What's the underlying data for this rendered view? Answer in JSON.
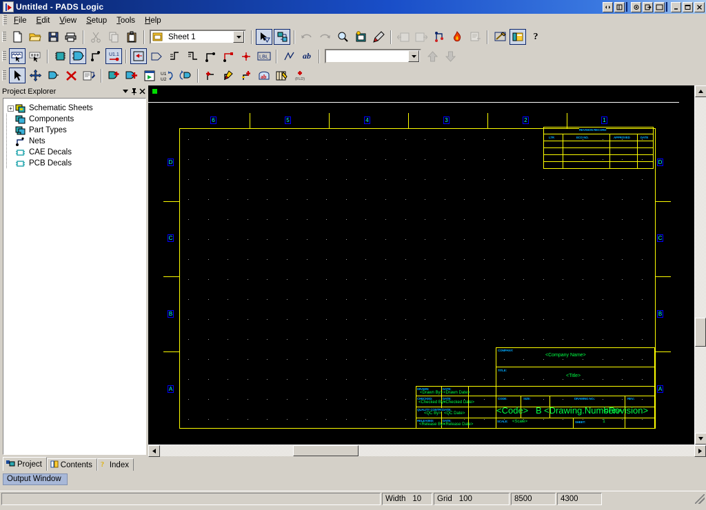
{
  "window": {
    "title": "Untitled - PADS Logic",
    "app_icon": "pads-logic-icon",
    "mdi_buttons": [
      "restore-window-icon",
      "close-child-icon"
    ],
    "sys_buttons": [
      "minimize-icon",
      "maximize-icon",
      "close-icon"
    ],
    "extra_buttons": [
      "camera-icon",
      "export-icon",
      "window-icon"
    ]
  },
  "menubar": {
    "items": [
      {
        "label": "File",
        "accel": "F"
      },
      {
        "label": "Edit",
        "accel": "E"
      },
      {
        "label": "View",
        "accel": "V"
      },
      {
        "label": "Setup",
        "accel": "S"
      },
      {
        "label": "Tools",
        "accel": "T"
      },
      {
        "label": "Help",
        "accel": "H"
      }
    ]
  },
  "toolbar_standard": {
    "sheet_combo": {
      "value": "Sheet 1",
      "icon": "sheet-icon"
    },
    "buttons": [
      {
        "name": "new-file-button",
        "tooltip": "New"
      },
      {
        "name": "open-file-button",
        "tooltip": "Open"
      },
      {
        "name": "save-file-button",
        "tooltip": "Save"
      },
      {
        "name": "print-button",
        "tooltip": "Print"
      },
      {
        "name": "cut-button",
        "tooltip": "Cut"
      },
      {
        "name": "copy-button",
        "tooltip": "Copy"
      },
      {
        "name": "paste-button",
        "tooltip": "Paste"
      },
      {
        "name": "select-tool-button",
        "tooltip": "Select"
      },
      {
        "name": "netlist-button",
        "tooltip": "Netlist"
      },
      {
        "name": "undo-button",
        "tooltip": "Undo"
      },
      {
        "name": "redo-button",
        "tooltip": "Redo"
      },
      {
        "name": "zoom-button",
        "tooltip": "Zoom"
      },
      {
        "name": "redraw-button",
        "tooltip": "Redraw"
      },
      {
        "name": "query-modify-button",
        "tooltip": "Query/Modify"
      },
      {
        "name": "previous-sheet-button",
        "tooltip": "Previous Sheet"
      },
      {
        "name": "next-sheet-button",
        "tooltip": "Next Sheet"
      },
      {
        "name": "nets-button",
        "tooltip": "Nets"
      },
      {
        "name": "hot-button",
        "tooltip": "Hot"
      },
      {
        "name": "report-button",
        "tooltip": "Reports"
      },
      {
        "name": "pads-layout-button",
        "tooltip": "PADS Layout Link"
      },
      {
        "name": "project-explorer-button",
        "tooltip": "Project Explorer"
      },
      {
        "name": "help-button",
        "tooltip": "Help"
      }
    ]
  },
  "toolbar_design": {
    "search_combo": {
      "value": "",
      "placeholder": ""
    },
    "buttons": [
      {
        "name": "selection-filter-button",
        "tooltip": "Selection Filter"
      },
      {
        "name": "select-anything-button",
        "tooltip": "Select Anything"
      },
      {
        "name": "add-part-button",
        "tooltip": "Add Part"
      },
      {
        "name": "add-gate-button",
        "tooltip": "Add Gate"
      },
      {
        "name": "add-connection-button",
        "tooltip": "Add Connection"
      },
      {
        "name": "label-part-button",
        "tooltip": "Label Part"
      },
      {
        "name": "hierarchy-symbol-button",
        "tooltip": "Hierarchy Symbol"
      },
      {
        "name": "off-page-symbol-button",
        "tooltip": "Off-Page Symbol"
      },
      {
        "name": "bus-in-button",
        "tooltip": "Bus In"
      },
      {
        "name": "bus-out-button",
        "tooltip": "Bus Out"
      },
      {
        "name": "net-segment-button",
        "tooltip": "Net Segment"
      },
      {
        "name": "net-corner-button",
        "tooltip": "Net Corner"
      },
      {
        "name": "junction-button",
        "tooltip": "Junction"
      },
      {
        "name": "label-button",
        "tooltip": "LBL"
      },
      {
        "name": "polyline-button",
        "tooltip": "Polyline"
      },
      {
        "name": "text-button",
        "tooltip": "ab Text"
      },
      {
        "name": "scroll-up-button",
        "tooltip": "Up"
      },
      {
        "name": "scroll-down-button",
        "tooltip": "Down"
      }
    ]
  },
  "toolbar_edit": {
    "buttons": [
      {
        "name": "pointer-button",
        "tooltip": "Select"
      },
      {
        "name": "move-button",
        "tooltip": "Move"
      },
      {
        "name": "rotate-gate-button",
        "tooltip": "Rotate"
      },
      {
        "name": "delete-button",
        "tooltip": "Delete"
      },
      {
        "name": "properties-button",
        "tooltip": "Properties"
      },
      {
        "name": "add-new-gate-button",
        "tooltip": "Add New Gate"
      },
      {
        "name": "add-new-part-button",
        "tooltip": "Add New Part"
      },
      {
        "name": "new-sheet-button",
        "tooltip": "New Sheet"
      },
      {
        "name": "swap-refdes-button",
        "tooltip": "U1/U2 Swap"
      },
      {
        "name": "swap-gate-button",
        "tooltip": "Swap Gate"
      },
      {
        "name": "add-pin-button",
        "tooltip": "Add Pin"
      },
      {
        "name": "edit-pin-button",
        "tooltip": "Edit Pin"
      },
      {
        "name": "add-signal-pin-button",
        "tooltip": "Add Signal Pin"
      },
      {
        "name": "attribute-button",
        "tooltip": "Attributes"
      },
      {
        "name": "edit-label-button",
        "tooltip": "Edit Label"
      },
      {
        "name": "edit-net-label-button",
        "tooltip": "Edit Net Label"
      },
      {
        "name": "ab-attribute-button",
        "tooltip": "Text Attribute"
      },
      {
        "name": "field-list-button",
        "tooltip": "Field List"
      },
      {
        "name": "add-field-button",
        "tooltip": "Add Field"
      }
    ]
  },
  "explorer": {
    "title": "Project Explorer",
    "header_buttons": [
      "dropdown-menu-icon",
      "pin-icon",
      "close-icon"
    ],
    "tree": [
      {
        "label": "Schematic Sheets",
        "icon": "schematic-sheets-icon",
        "expandable": true,
        "expander": "+"
      },
      {
        "label": "Components",
        "icon": "components-icon",
        "expandable": false
      },
      {
        "label": "Part Types",
        "icon": "part-types-icon",
        "expandable": false
      },
      {
        "label": "Nets",
        "icon": "nets-icon",
        "expandable": false
      },
      {
        "label": "CAE Decals",
        "icon": "cae-decals-icon",
        "expandable": false
      },
      {
        "label": "PCB Decals",
        "icon": "pcb-decals-icon",
        "expandable": false
      }
    ],
    "tabs": [
      {
        "label": "Project",
        "icon": "project-icon",
        "active": true
      },
      {
        "label": "Contents",
        "icon": "contents-icon",
        "active": false
      },
      {
        "label": "Index",
        "icon": "index-icon",
        "active": false
      }
    ]
  },
  "output_window": {
    "label": "Output Window"
  },
  "statusbar": {
    "message": "",
    "width_label": "Width",
    "width_value": "10",
    "grid_label": "Grid",
    "grid_value": "100",
    "coord_x": "8500",
    "coord_y": "4300"
  },
  "schematic": {
    "zones_top": [
      "6",
      "5",
      "4",
      "3",
      "2",
      "1"
    ],
    "zones_left": [
      "D",
      "C",
      "B",
      "A"
    ],
    "zones_right": [
      "D",
      "C",
      "B",
      "A"
    ],
    "revision_table": {
      "title": "REVISION RECORD",
      "columns": [
        "LTR",
        "ECO NO.",
        "APPROVED",
        "DATE"
      ],
      "rows": 4
    },
    "title_block": {
      "company_label": "COMPANY:",
      "company_value": "<Company Name>",
      "title_label": "TITLE:",
      "title_value": "<Title>",
      "fields": [
        {
          "label": "DRAWN:",
          "value": "<Drawn By>",
          "date_label": "DATE:",
          "date_value": "<Drawn Date>"
        },
        {
          "label": "CHECKED:",
          "value": "<Checked By>",
          "date_label": "DATE:",
          "date_value": "<Checked Date>"
        },
        {
          "label": "QUALITY CONTROL:",
          "value": "<QC By>",
          "date_label": "DATE:",
          "date_value": "<QC Date>"
        },
        {
          "label": "RELEASED:",
          "value": "<Release By>",
          "date_label": "DATE:",
          "date_value": "<Release Date>"
        }
      ],
      "code_label": "CODE:",
      "code_value": "<Code>",
      "size_label": "SIZE:",
      "size_value": "B",
      "drawing_no_label": "DRAWING NO.:",
      "drawing_no_value": "<Drawing.Number>",
      "rev_label": "REV.:",
      "rev_value": "<Revision>",
      "scale_label": "SCALE:",
      "scale_value": "<Scale>",
      "sheet_label": "SHEET:",
      "sheet_value": "1",
      "zone_letter": "A"
    },
    "colors": {
      "border": "#ffff00",
      "placeholder_text": "#00ff44",
      "field_label": "#00aaff",
      "zone_text": "#00ffff",
      "zone_box": "#0000ff",
      "background": "#000000",
      "origin_marker": "#00dd00"
    }
  }
}
